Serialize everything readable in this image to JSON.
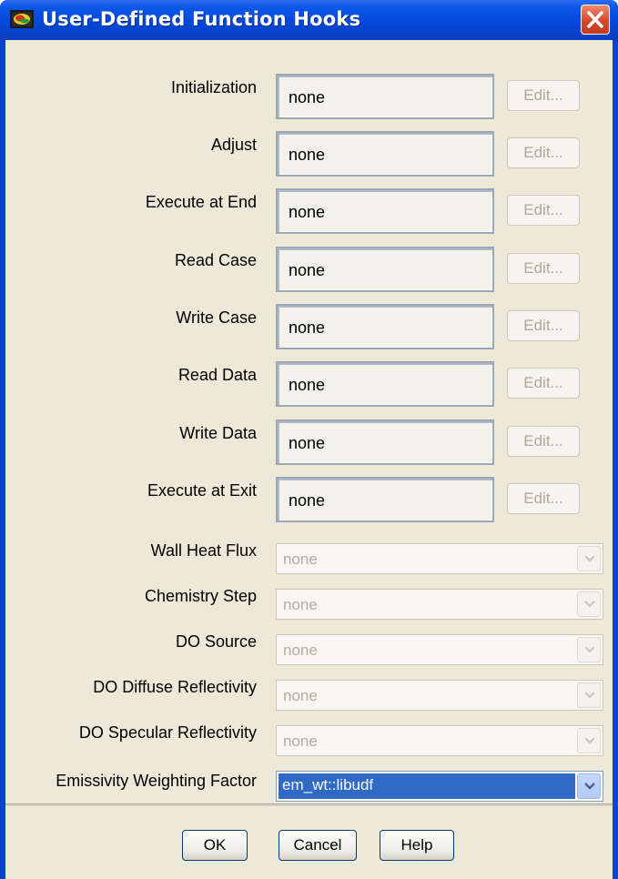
{
  "window": {
    "title": "User-Defined Function Hooks"
  },
  "hooks": [
    {
      "label": "Initialization",
      "value": "none",
      "edit_label": "Edit..."
    },
    {
      "label": "Adjust",
      "value": "none",
      "edit_label": "Edit..."
    },
    {
      "label": "Execute at End",
      "value": "none",
      "edit_label": "Edit..."
    },
    {
      "label": "Read Case",
      "value": "none",
      "edit_label": "Edit..."
    },
    {
      "label": "Write Case",
      "value": "none",
      "edit_label": "Edit..."
    },
    {
      "label": "Read Data",
      "value": "none",
      "edit_label": "Edit..."
    },
    {
      "label": "Write Data",
      "value": "none",
      "edit_label": "Edit..."
    },
    {
      "label": "Execute at Exit",
      "value": "none",
      "edit_label": "Edit..."
    }
  ],
  "dropdowns": [
    {
      "label": "Wall Heat Flux",
      "value": "none",
      "enabled": false
    },
    {
      "label": "Chemistry Step",
      "value": "none",
      "enabled": false
    },
    {
      "label": "DO Source",
      "value": "none",
      "enabled": false
    },
    {
      "label": "DO Diffuse Reflectivity",
      "value": "none",
      "enabled": false
    },
    {
      "label": "DO Specular Reflectivity",
      "value": "none",
      "enabled": false
    },
    {
      "label": "Emissivity Weighting Factor",
      "value": "em_wt::libudf",
      "enabled": true
    }
  ],
  "buttons": {
    "ok": "OK",
    "cancel": "Cancel",
    "help": "Help"
  },
  "colors": {
    "titlebar": "#0447d6",
    "dialog_bg": "#ece9d8",
    "selection": "#316ac5",
    "disabled_text": "#aca899"
  }
}
